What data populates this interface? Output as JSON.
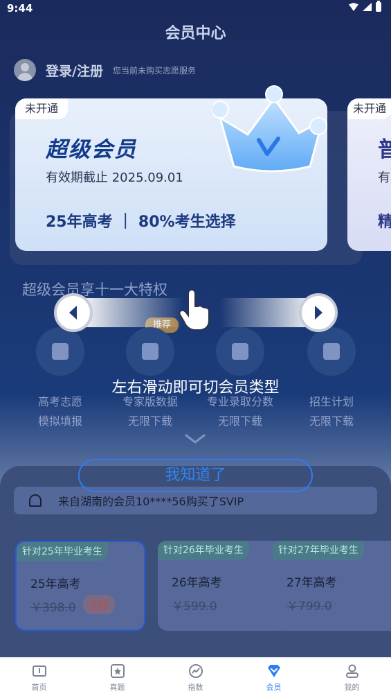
{
  "status_bar": {
    "time": "9:44"
  },
  "header": {
    "title": "会员中心"
  },
  "login": {
    "label": "登录/注册",
    "subtitle": "您当前未购买志愿服务"
  },
  "cards": {
    "main": {
      "tag": "未开通",
      "title": "超级会员",
      "expiry": "有效期截止 2025.09.01",
      "tagline": "25年高考 ｜ 80%考生选择"
    },
    "side": {
      "tag": "未开通",
      "title_partial": "普",
      "line_partial": "有",
      "bottom_partial": "精"
    }
  },
  "privileges": {
    "title": "超级会员享十一大特权",
    "badge": "推荐",
    "features": [
      {
        "name": "高考志愿",
        "desc": "模拟填报",
        "icon": "graduation-cap-icon"
      },
      {
        "name": "专家版数据",
        "desc": "无限下载",
        "icon": "bar-chart-icon"
      },
      {
        "name": "专业录取分数",
        "desc": "无限下载",
        "icon": "trend-chart-icon"
      },
      {
        "name": "招生计划",
        "desc": "无限下载",
        "icon": "bookmark-star-icon"
      }
    ]
  },
  "notice": {
    "text": "来自湖南的会员10****56购买了SVIP"
  },
  "plans": [
    {
      "tag": "针对25年毕业考生",
      "year": "25年高考",
      "price": "￥398.0",
      "discount": "5折"
    },
    {
      "tag": "针对26年毕业考生",
      "year": "26年高考",
      "price": "￥599.0"
    },
    {
      "tag": "针对27年毕业考生",
      "year": "27年高考",
      "price": "￥799.0"
    }
  ],
  "guide": {
    "hint": "左右滑动即可切会员类型",
    "ok_label": "我知道了"
  },
  "nav": [
    {
      "label": "首页",
      "icon": "home-book-icon"
    },
    {
      "label": "真题",
      "icon": "star-document-icon"
    },
    {
      "label": "指数",
      "icon": "gauge-icon"
    },
    {
      "label": "会员",
      "icon": "vip-diamond-icon",
      "active": true
    },
    {
      "label": "我的",
      "icon": "user-icon"
    }
  ],
  "colors": {
    "accent": "#2f7df0",
    "card_title": "#123a8a",
    "overlay": "#1a2b55"
  }
}
